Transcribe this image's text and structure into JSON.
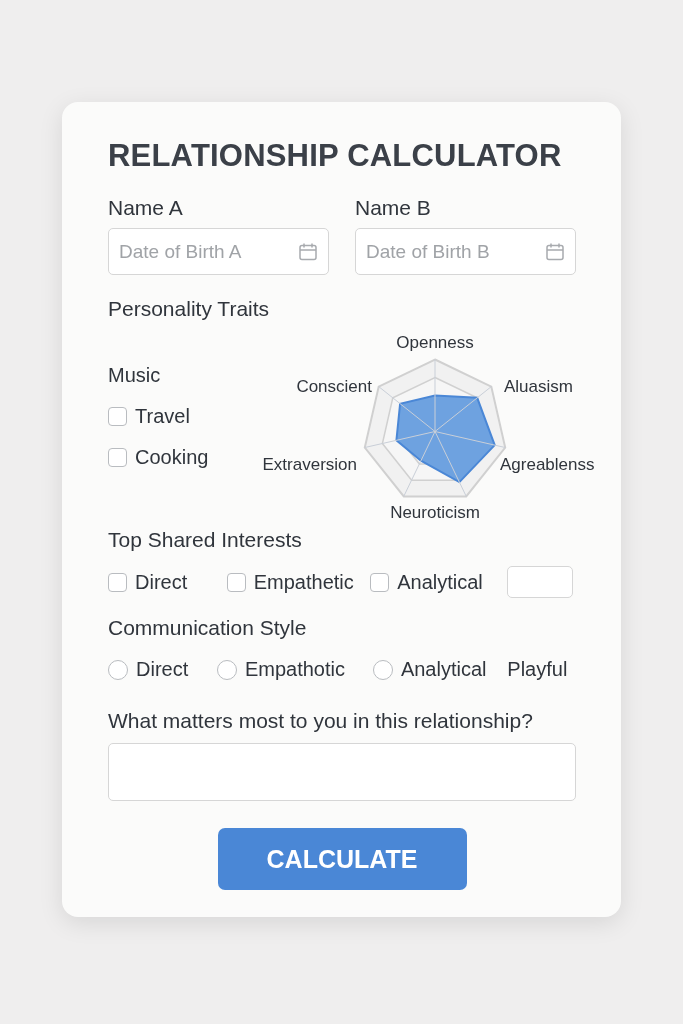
{
  "title": "RELATIONSHIP CALCULATOR",
  "people": [
    {
      "name_label": "Name A",
      "date_placeholder": "Date of Birth A"
    },
    {
      "name_label": "Name B",
      "date_placeholder": "Date of Birth B"
    }
  ],
  "personality": {
    "heading": "Personality Traits",
    "interests": [
      {
        "kind": "label",
        "label": "Music"
      },
      {
        "kind": "checkbox",
        "label": "Travel",
        "checked": false
      },
      {
        "kind": "checkbox",
        "label": "Cooking",
        "checked": false
      }
    ],
    "radar_axes": [
      "Openness",
      "Aluasism",
      "Agreablenss",
      "Neuroticism",
      "Extraversion",
      "Conscient"
    ]
  },
  "shared_interests": {
    "heading": "Top Shared Interests",
    "options": [
      {
        "kind": "checkbox",
        "label": "Direct",
        "checked": false
      },
      {
        "kind": "checkbox",
        "label": "Empathetic",
        "checked": false
      },
      {
        "kind": "checkbox",
        "label": "Analytical",
        "checked": false
      },
      {
        "kind": "field"
      }
    ]
  },
  "communication": {
    "heading": "Communication Style",
    "options": [
      {
        "kind": "radio",
        "label": "Direct",
        "selected": false
      },
      {
        "kind": "radio",
        "label": "Empathotic",
        "selected": false
      },
      {
        "kind": "radio",
        "label": "Analytical",
        "selected": false
      },
      {
        "kind": "label",
        "label": "Playful"
      }
    ]
  },
  "question": {
    "label": "What matters most to you in this relationship?"
  },
  "button": "CALCULATE"
}
